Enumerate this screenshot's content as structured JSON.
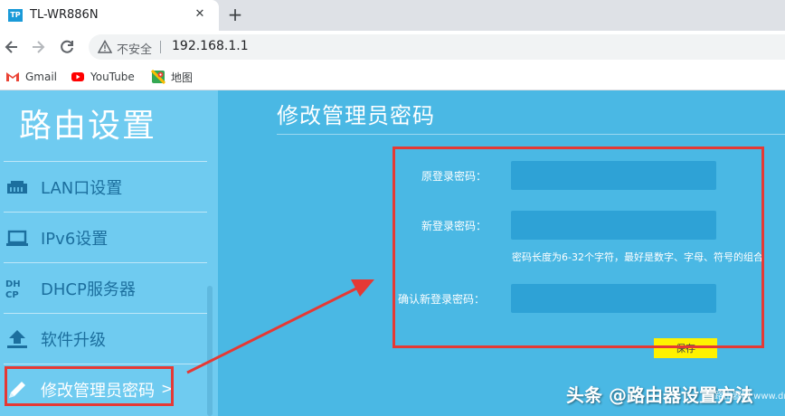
{
  "browser": {
    "tab_title": "TL-WR886N",
    "favicon_text": "TP",
    "close_glyph": "✕",
    "new_tab_glyph": "+",
    "insecure_label": "不安全",
    "url": "192.168.1.1",
    "bookmarks": [
      {
        "label": "Gmail",
        "icon": "gmail-icon"
      },
      {
        "label": "YouTube",
        "icon": "youtube-icon"
      },
      {
        "label": "地图",
        "icon": "maps-icon"
      }
    ]
  },
  "sidebar": {
    "brand": "路由设置",
    "items": [
      {
        "label": "LAN口设置",
        "icon": "ethernet-icon"
      },
      {
        "label": "IPv6设置",
        "icon": "laptop-icon"
      },
      {
        "label": "DHCP服务器",
        "icon": "dhcp-icon"
      },
      {
        "label": "软件升级",
        "icon": "upload-icon"
      },
      {
        "label": "修改管理员密码",
        "icon": "pencil-icon",
        "chevron": ">"
      }
    ]
  },
  "content": {
    "title": "修改管理员密码",
    "fields": {
      "old_password_label": "原登录密码：",
      "new_password_label": "新登录密码：",
      "confirm_password_label": "确认新登录密码：",
      "old_password_value": "",
      "new_password_value": "",
      "confirm_password_value": ""
    },
    "hint": "密码长度为6-32个字符，最好是数字、字母、符号的组合",
    "save_label": "保存"
  },
  "watermark": {
    "main": "头条 @路由器设置方法",
    "small": "路由器网 www.dnzp.com"
  },
  "colors": {
    "page_bg": "#4ab8e4",
    "sidebar_bg": "#6fcbf0",
    "input_bg": "#2ea2d6",
    "save_button": "#fff200",
    "annotation_red": "#e53935"
  }
}
